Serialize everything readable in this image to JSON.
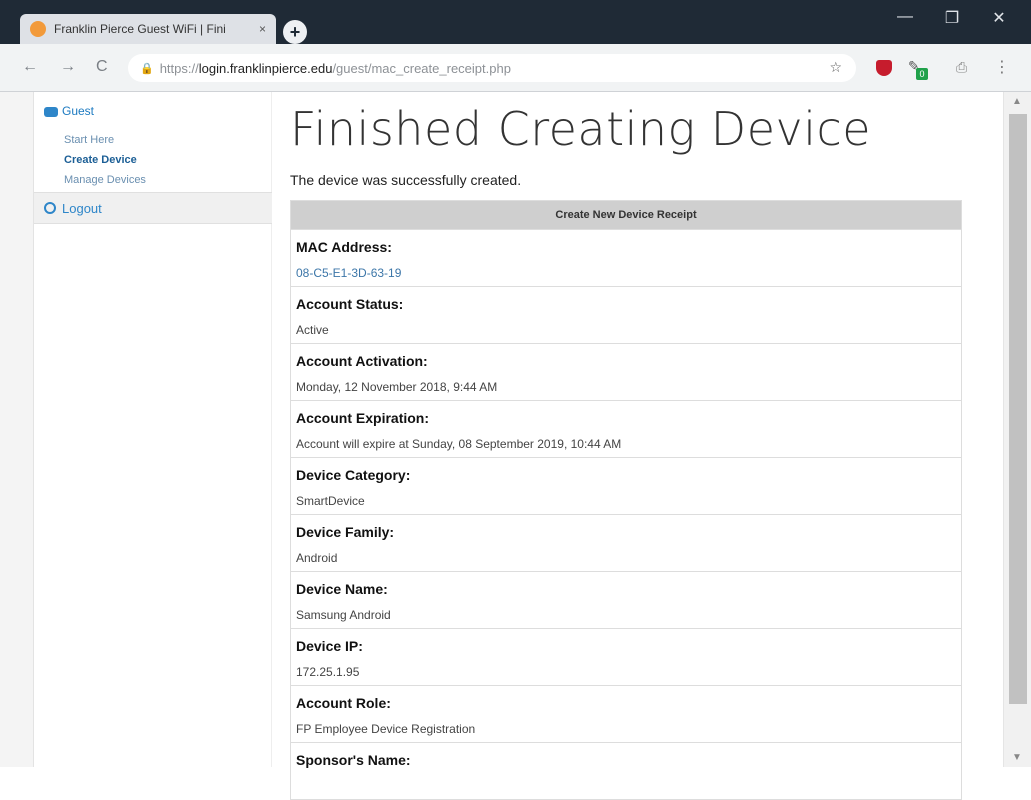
{
  "browser": {
    "tab_title": "Franklin Pierce Guest WiFi | Fini",
    "tab_close": "×",
    "new_tab": "+",
    "minimize": "—",
    "maximize": "❐",
    "close": "✕",
    "back": "←",
    "forward": "→",
    "reload": "C",
    "url_scheme": "https://",
    "url_host": "login.franklinpierce.edu",
    "url_path": "/guest/mac_create_receipt.php",
    "star": "☆",
    "ext_badge": "0",
    "menu": "⋮"
  },
  "sidebar": {
    "guest": "Guest",
    "start_here": "Start Here",
    "create_device": "Create Device",
    "manage_devices": "Manage Devices",
    "logout": "Logout"
  },
  "main": {
    "title": "Finished Creating Device",
    "subtitle": "The device was successfully created.",
    "receipt_title": "Create New Device Receipt",
    "rows": [
      {
        "label": "MAC Address:",
        "value": "08-C5-E1-3D-63-19"
      },
      {
        "label": "Account Status:",
        "value": "Active"
      },
      {
        "label": "Account Activation:",
        "value": "Monday, 12 November 2018, 9:44 AM"
      },
      {
        "label": "Account Expiration:",
        "value": "Account will expire at Sunday, 08 September 2019, 10:44 AM"
      },
      {
        "label": "Device Category:",
        "value": "SmartDevice"
      },
      {
        "label": "Device Family:",
        "value": "Android"
      },
      {
        "label": "Device Name:",
        "value": "Samsung Android"
      },
      {
        "label": "Device IP:",
        "value": "172.25.1.95"
      },
      {
        "label": "Account Role:",
        "value": "FP Employee Device Registration"
      },
      {
        "label": "Sponsor's Name:",
        "value": ""
      }
    ]
  },
  "colors": {
    "accent": "#1c7ac1",
    "titlebar": "#1f2a36",
    "receipt_header": "#cfcfcf"
  }
}
